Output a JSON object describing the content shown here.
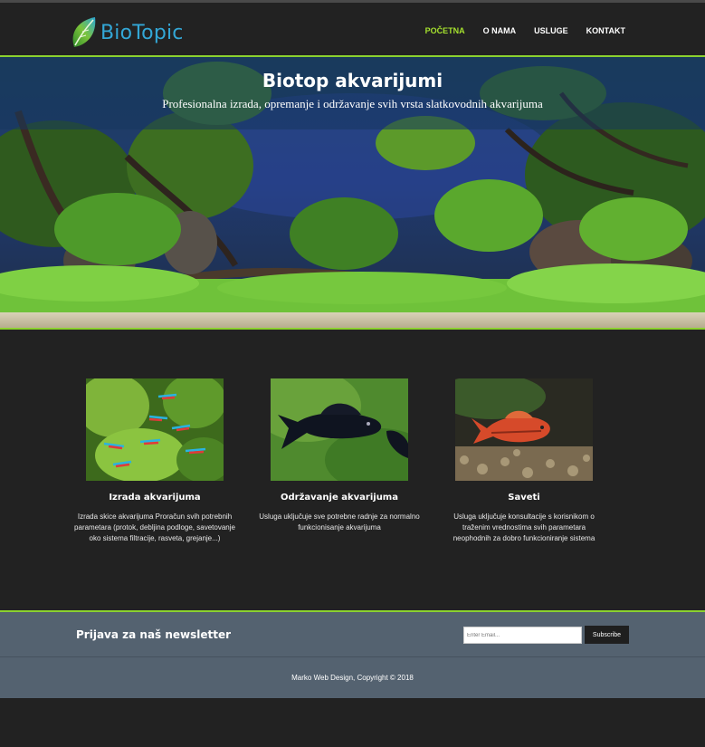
{
  "brand": {
    "name": "BioTopic",
    "color": "#33a7d6",
    "icon": "leaf-icon"
  },
  "nav": {
    "items": [
      {
        "label": "POČETNA",
        "active": true
      },
      {
        "label": "O NAMA",
        "active": false
      },
      {
        "label": "USLUGE",
        "active": false
      },
      {
        "label": "KONTAKT",
        "active": false
      }
    ]
  },
  "hero": {
    "title": "Biotop akvarijumi",
    "subtitle": "Profesionalna izrada, opremanje i održavanje svih vrsta slatkovodnih akvarijuma"
  },
  "features": [
    {
      "title": "Izrada akvarijuma",
      "text": "Izrada skice akvarijuma Proračun svih potrebnih parametara (protok, debljina podloge, savetovanje oko sistema filtracije, rasveta, grejanje...)"
    },
    {
      "title": "Održavanje akvarijuma",
      "text": "Usluga uključuje sve potrebne radnje za normalno funkcionisanje akvarijuma"
    },
    {
      "title": "Saveti",
      "text": "Usluga uključuje konsultacije s korisnikom o traženim vrednostima svih parametara neophodnih za dobro funkcioniranje sistema"
    }
  ],
  "newsletter": {
    "heading": "Prijava za naš newsletter",
    "placeholder": "Enter Email...",
    "button": "Subscribe"
  },
  "footer": {
    "text": "Marko Web Design, Copyright © 2018"
  },
  "colors": {
    "accent": "#a6e22e",
    "band": "#546270",
    "background": "#222222"
  }
}
